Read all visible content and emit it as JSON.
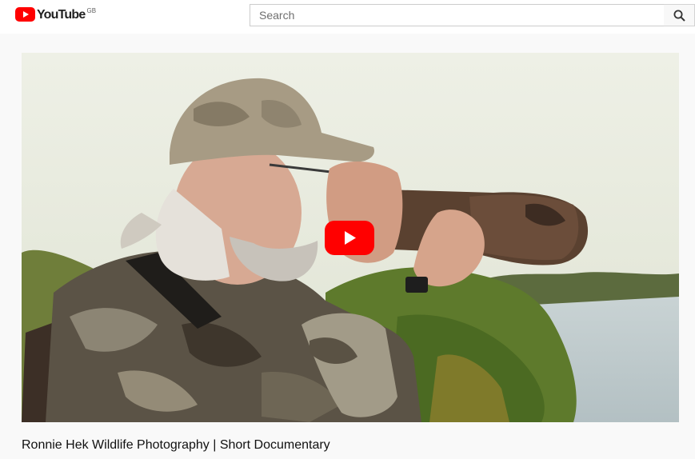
{
  "header": {
    "logo_text": "YouTube",
    "region": "GB",
    "search": {
      "placeholder": "Search",
      "value": ""
    },
    "icons": {
      "logo": "youtube-logo-icon",
      "search": "search-icon"
    }
  },
  "player": {
    "play_icon": "play-icon",
    "colors": {
      "play_button": "#ff0000",
      "logo_red": "#ff0000"
    }
  },
  "video": {
    "title": "Ronnie Hek Wildlife Photography | Short Documentary"
  }
}
